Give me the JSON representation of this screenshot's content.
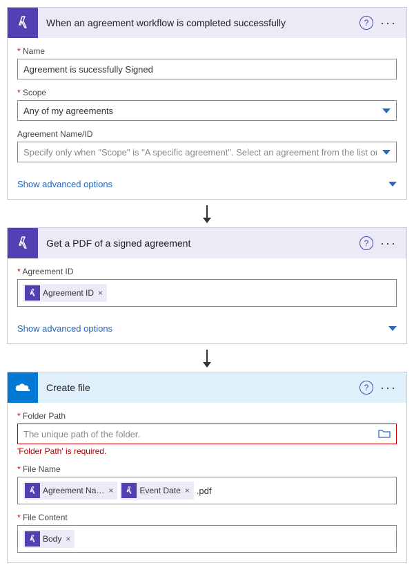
{
  "card1": {
    "title": "When an agreement workflow is completed successfully",
    "name_label": "Name",
    "name_value": "Agreement is sucessfully Signed",
    "scope_label": "Scope",
    "scope_value": "Any of my agreements",
    "agid_label": "Agreement Name/ID",
    "agid_placeholder": "Specify only when \"Scope\" is \"A specific agreement\". Select an agreement from the list or enter th",
    "advanced": "Show advanced options"
  },
  "card2": {
    "title": "Get a PDF of a signed agreement",
    "agid_label": "Agreement ID",
    "token": "Agreement ID",
    "advanced": "Show advanced options"
  },
  "card3": {
    "title": "Create file",
    "folder_label": "Folder Path",
    "folder_placeholder": "The unique path of the folder.",
    "folder_error": "'Folder Path' is required.",
    "filename_label": "File Name",
    "token_name": "Agreement Na…",
    "token_date": "Event Date",
    "suffix": ".pdf",
    "content_label": "File Content",
    "token_body": "Body"
  }
}
